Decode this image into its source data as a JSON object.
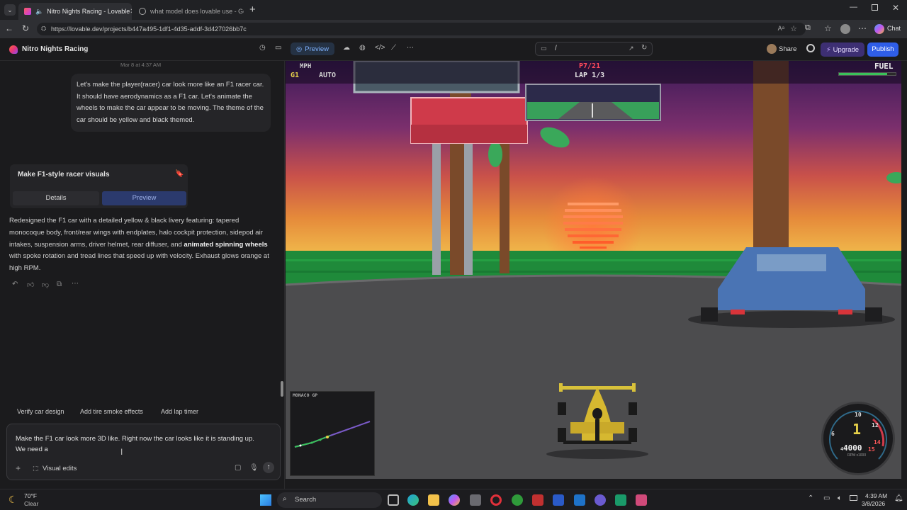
{
  "browser": {
    "tabs": [
      {
        "title": "Nitro Nights Racing - Lovable",
        "active": true
      },
      {
        "title": "what model does lovable use - Go",
        "active": false
      }
    ],
    "url": "https://lovable.dev/projects/b447a495-1df1-4d35-addf-3d427026bb7c"
  },
  "header": {
    "project_name": "Nitro Nights Racing",
    "preview_label": "Preview",
    "route_path": "/",
    "share_label": "Share",
    "upgrade_label": "Upgrade",
    "publish_label": "Publish",
    "chat_label": "Chat"
  },
  "chat": {
    "timestamp": "Mar 8 at 4:37 AM",
    "user_message": "Let's make the player(racer) car look more like an F1 racer car. It should have aerodynamics as a F1 car. Let's animate the wheels to make the car appear to be moving. The theme of the car should be yellow and black themed.",
    "card_title": "Make F1-style racer visuals",
    "card_tabs": [
      "Details",
      "Preview"
    ],
    "response_part1": "Redesigned the F1 car with a detailed yellow & black livery featuring: tapered monocoque body, front/rear wings with endplates, halo cockpit protection, sidepod air intakes, suspension arms, driver helmet, rear diffuser, and ",
    "response_bold1": "animated spinning wheels",
    "response_part2": " with spoke rotation and tread lines that speed up with velocity. Exhaust glows orange at high RPM.",
    "suggestions": [
      "Verify car design",
      "Add tire smoke effects",
      "Add lap timer"
    ],
    "input_text": "Make the F1 car look more 3D like. Right now the car looks like it is standing up. We need a",
    "visual_edits_label": "Visual edits"
  },
  "game": {
    "speed_unit": "MPH",
    "gear": "G1",
    "transmission": "AUTO",
    "position": "P7/21",
    "lap": "LAP 1/3",
    "fuel_label": "FUEL",
    "fuel_level": 0.85,
    "minimap_title": "MONACO GP",
    "gauge_gear": "1",
    "gauge_rpm": "4000",
    "gauge_rpm_unit": "RPM x1000",
    "gauge_ticks": [
      "6",
      "10",
      "12",
      "14",
      "15",
      "4"
    ]
  },
  "taskbar": {
    "weather_temp": "70°F",
    "weather_desc": "Clear",
    "search_placeholder": "Search",
    "time": "4:39 AM",
    "date": "3/8/2026"
  }
}
